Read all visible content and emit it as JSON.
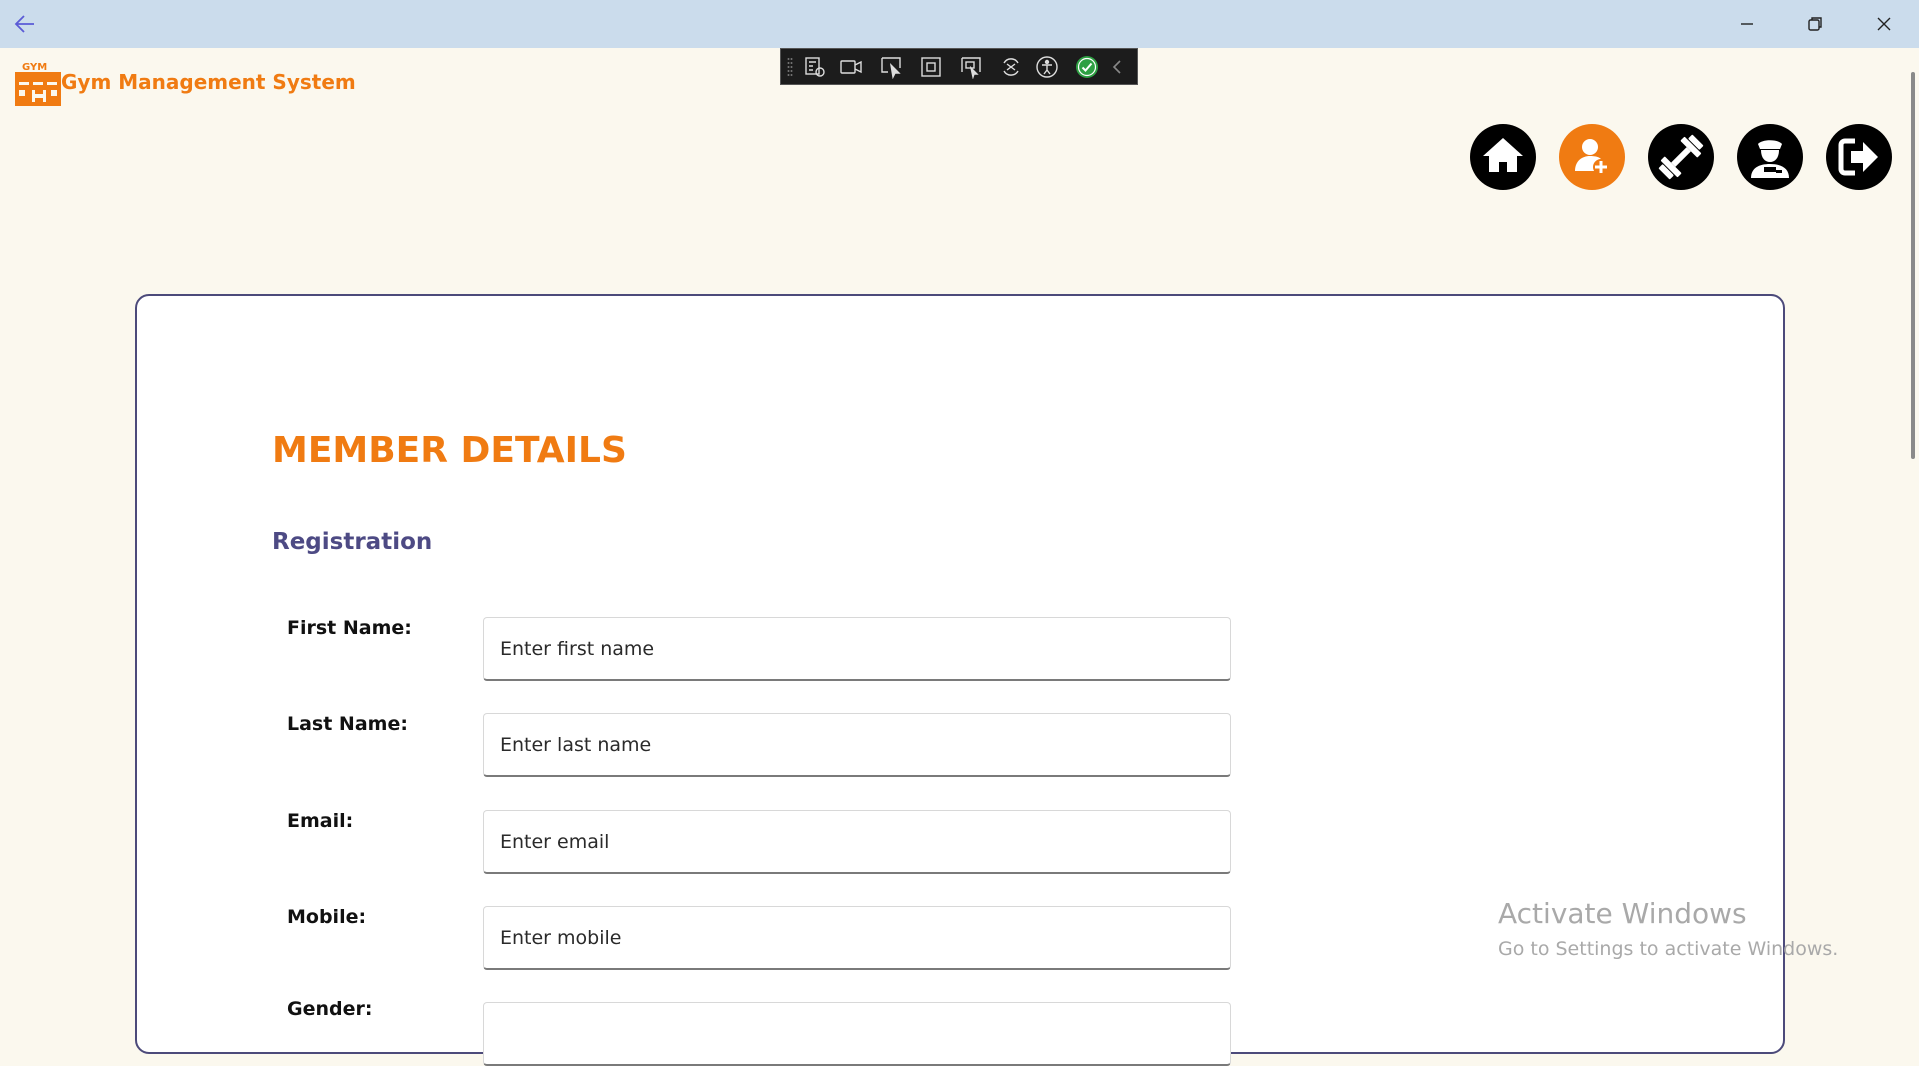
{
  "app": {
    "title": "Gym Management System",
    "logo_text": "GYM",
    "accent_color": "#f07b12",
    "secondary_color": "#4d4a84"
  },
  "titlebar": {
    "back_icon": "back-arrow-icon",
    "minimize_icon": "minimize-icon",
    "maximize_icon": "restore-icon",
    "close_icon": "close-icon"
  },
  "debug_toolbar": {
    "icons": [
      "live-visual-tree-icon",
      "video-icon",
      "select-element-icon",
      "display-layout-adorners-icon",
      "track-focus-icon",
      "hot-reload-icon",
      "accessibility-icon",
      "checkmark-icon",
      "collapse-chevron-icon"
    ]
  },
  "nav": {
    "items": [
      {
        "icon": "home-icon",
        "active": false
      },
      {
        "icon": "add-member-icon",
        "active": true
      },
      {
        "icon": "equipment-icon",
        "active": false
      },
      {
        "icon": "trainer-icon",
        "active": false
      },
      {
        "icon": "logout-icon",
        "active": false
      }
    ]
  },
  "form": {
    "page_title": "MEMBER DETAILS",
    "section_title": "Registration",
    "fields": [
      {
        "label": "First Name:",
        "placeholder": "Enter first name",
        "value": ""
      },
      {
        "label": "Last Name:",
        "placeholder": "Enter last name",
        "value": ""
      },
      {
        "label": "Email:",
        "placeholder": "Enter email",
        "value": ""
      },
      {
        "label": "Mobile:",
        "placeholder": "Enter mobile",
        "value": ""
      },
      {
        "label": "Gender:",
        "placeholder": "",
        "value": ""
      }
    ]
  },
  "watermark": {
    "title": "Activate Windows",
    "subtitle": "Go to Settings to activate Windows."
  }
}
